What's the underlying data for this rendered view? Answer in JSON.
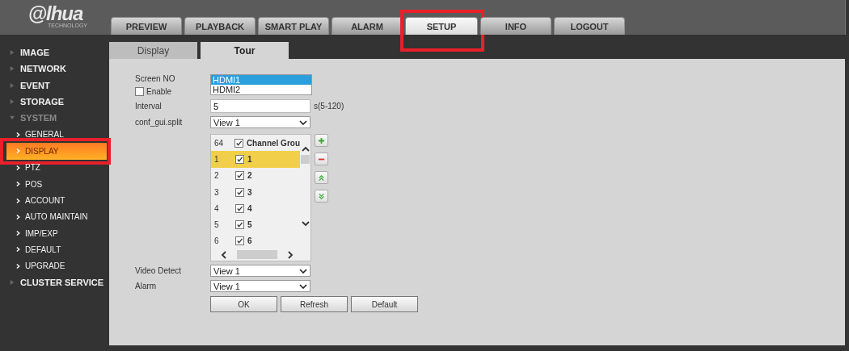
{
  "logo": {
    "text": "@lhua",
    "tagline": "TECHNOLOGY"
  },
  "tabs": [
    {
      "label": "PREVIEW",
      "selected": false,
      "highlighted": false
    },
    {
      "label": "PLAYBACK",
      "selected": false,
      "highlighted": false
    },
    {
      "label": "SMART PLAY",
      "selected": false,
      "highlighted": false
    },
    {
      "label": "ALARM",
      "selected": false,
      "highlighted": false
    },
    {
      "label": "SETUP",
      "selected": true,
      "highlighted": true
    },
    {
      "label": "INFO",
      "selected": false,
      "highlighted": false
    },
    {
      "label": "LOGOUT",
      "selected": false,
      "highlighted": false
    }
  ],
  "sidebar": {
    "items": [
      {
        "label": "IMAGE",
        "expanded": false
      },
      {
        "label": "NETWORK",
        "expanded": false
      },
      {
        "label": "EVENT",
        "expanded": false
      },
      {
        "label": "STORAGE",
        "expanded": false
      },
      {
        "label": "SYSTEM",
        "expanded": true,
        "children": [
          {
            "label": "GENERAL",
            "selected": false,
            "highlighted": false
          },
          {
            "label": "DISPLAY",
            "selected": true,
            "highlighted": true
          },
          {
            "label": "PTZ",
            "selected": false,
            "highlighted": false
          },
          {
            "label": "POS",
            "selected": false,
            "highlighted": false
          },
          {
            "label": "ACCOUNT",
            "selected": false,
            "highlighted": false
          },
          {
            "label": "AUTO MAINTAIN",
            "selected": false,
            "highlighted": false
          },
          {
            "label": "IMP/EXP",
            "selected": false,
            "highlighted": false
          },
          {
            "label": "DEFAULT",
            "selected": false,
            "highlighted": false
          },
          {
            "label": "UPGRADE",
            "selected": false,
            "highlighted": false
          }
        ]
      },
      {
        "label": "CLUSTER SERVICE",
        "expanded": false
      }
    ]
  },
  "subtabs": [
    {
      "label": "Display",
      "selected": false
    },
    {
      "label": "Tour",
      "selected": true
    }
  ],
  "form": {
    "screen_no": {
      "label": "Screen NO",
      "options": [
        {
          "label": "HDMI1",
          "selected": true
        },
        {
          "label": "HDMI2",
          "selected": false
        }
      ]
    },
    "enable": {
      "label": "Enable",
      "checked": false
    },
    "interval": {
      "label": "Interval",
      "value": "5",
      "hint": "s(5-120)"
    },
    "split": {
      "label": "conf_gui.split",
      "value": "View 1"
    },
    "channel_list": {
      "header": {
        "number": "64",
        "checked": true,
        "label": "Channel Grou"
      },
      "rows": [
        {
          "number": "1",
          "checked": true,
          "label": "1",
          "selected": true
        },
        {
          "number": "2",
          "checked": true,
          "label": "2",
          "selected": false
        },
        {
          "number": "3",
          "checked": true,
          "label": "3",
          "selected": false
        },
        {
          "number": "4",
          "checked": true,
          "label": "4",
          "selected": false
        },
        {
          "number": "5",
          "checked": true,
          "label": "5",
          "selected": false
        },
        {
          "number": "6",
          "checked": true,
          "label": "6",
          "selected": false
        }
      ]
    },
    "video_detect": {
      "label": "Video Detect",
      "value": "View 1"
    },
    "alarm": {
      "label": "Alarm",
      "value": "View 1"
    },
    "buttons": [
      "OK",
      "Refresh",
      "Default"
    ]
  }
}
